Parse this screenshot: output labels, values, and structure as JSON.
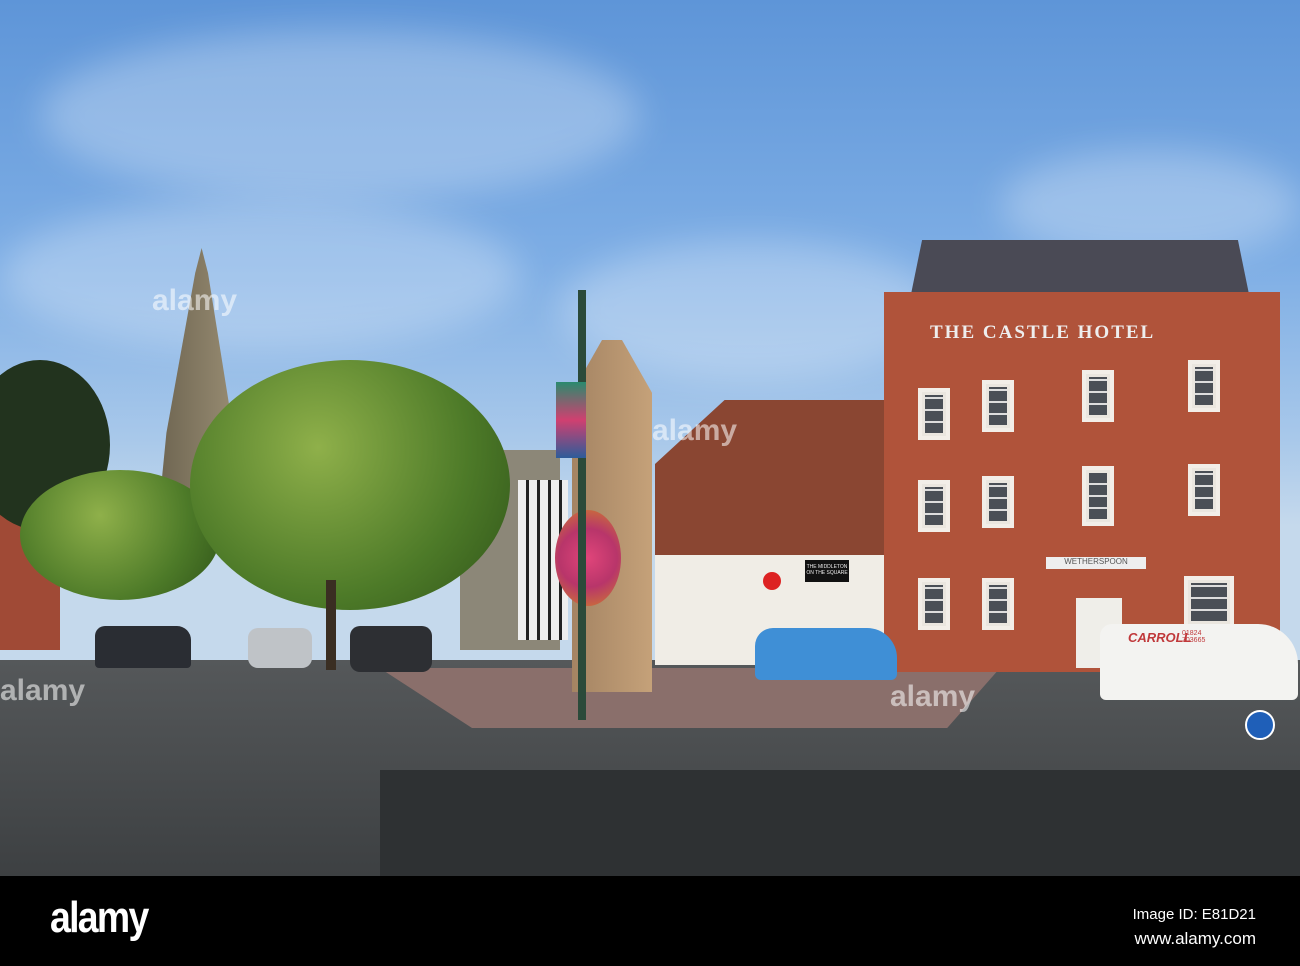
{
  "photo": {
    "hotel_sign": "THE CASTLE HOTEL",
    "pub_sign": "WETHERSPOON",
    "inn_sign": "THE MIDDLETON ON THE SQUARE",
    "van_brand": "CARROLL",
    "van_phone": "01824 703665"
  },
  "watermark": {
    "text": "alamy"
  },
  "footer": {
    "logo": "alamy",
    "image_id": "Image ID: E81D21",
    "url": "www.alamy.com"
  }
}
